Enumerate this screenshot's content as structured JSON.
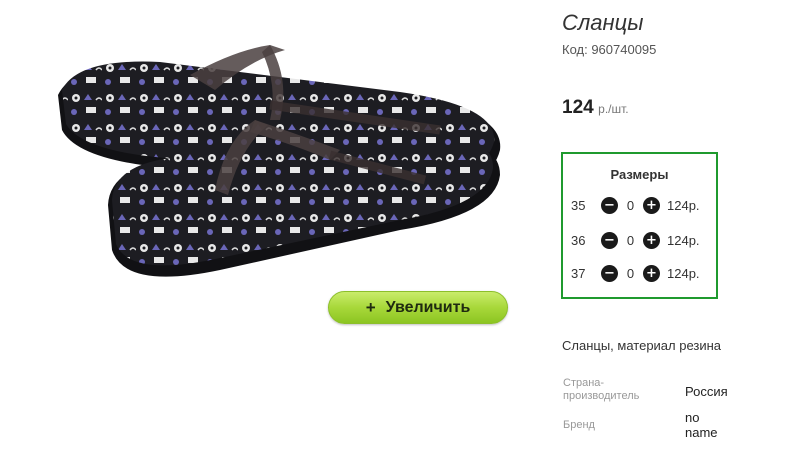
{
  "product": {
    "title": "Сланцы",
    "code": "Код: 960740095",
    "price": "124",
    "price_unit": "р./шт.",
    "zoom_label": "Увеличить",
    "zoom_icon": "plus"
  },
  "sizes": {
    "title": "Размеры",
    "rows": [
      {
        "size": "35",
        "qty": "0",
        "price": "124р."
      },
      {
        "size": "36",
        "qty": "0",
        "price": "124р."
      },
      {
        "size": "37",
        "qty": "0",
        "price": "124р."
      }
    ]
  },
  "description": "Сланцы, материал резина",
  "properties": [
    {
      "label_line1": "Страна-",
      "label_line2": "производитель",
      "value": "Россия"
    },
    {
      "label": "Бренд",
      "value_line1": "no",
      "value_line2": "name"
    }
  ],
  "colors": {
    "accent_border": "#1f9a2e",
    "button_green": "#a8d83a"
  }
}
